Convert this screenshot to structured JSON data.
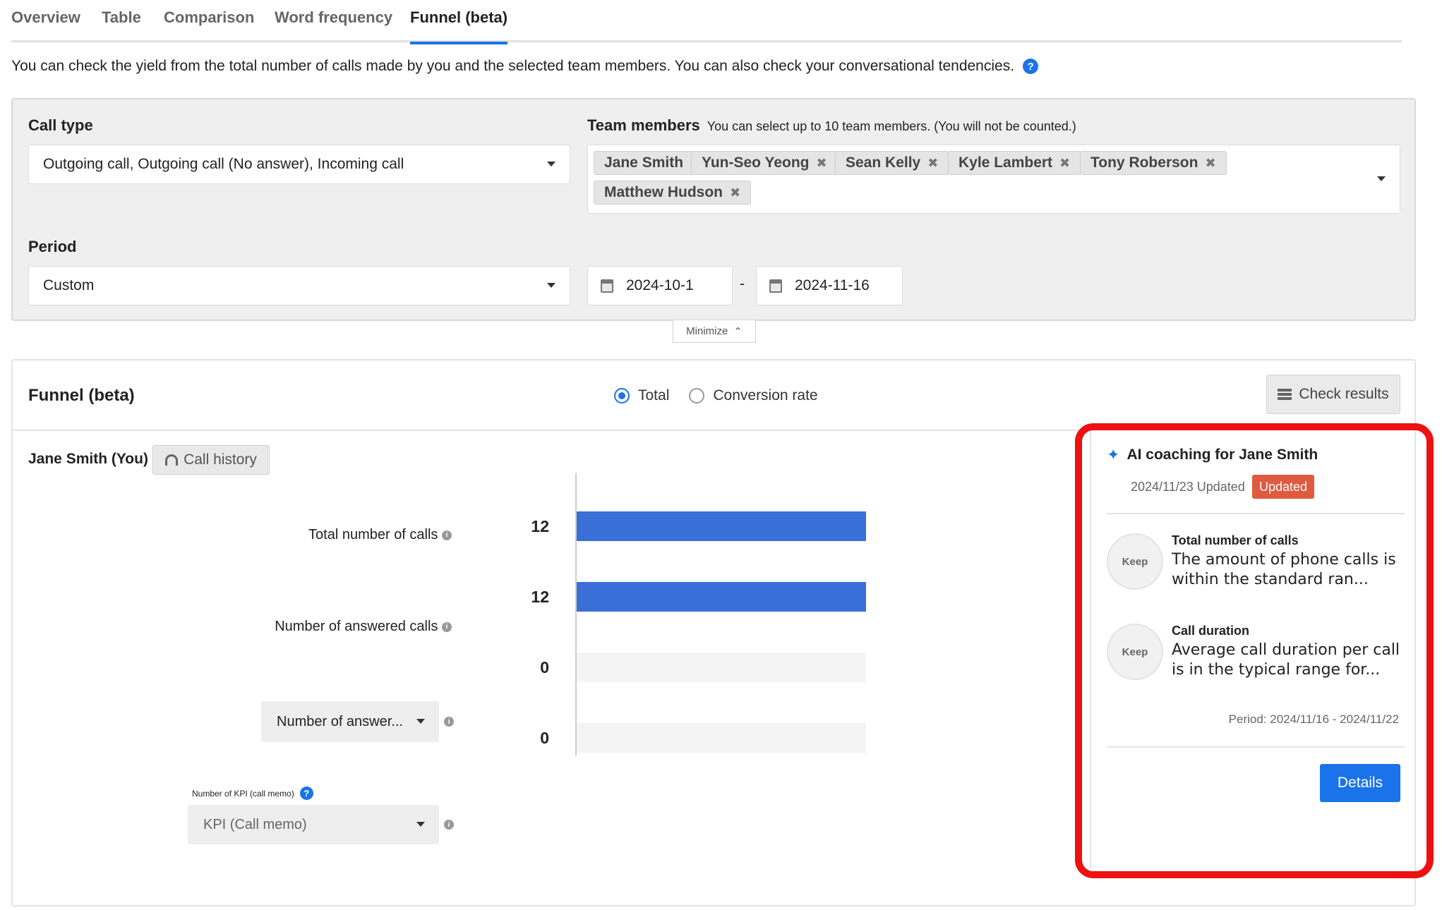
{
  "tabs": [
    {
      "label": "Overview"
    },
    {
      "label": "Table"
    },
    {
      "label": "Comparison"
    },
    {
      "label": "Word frequency"
    },
    {
      "label": "Funnel (beta)",
      "active": true
    }
  ],
  "description": "You can check the yield from the total number of calls made by you and the selected team members. You can also check your conversational tendencies.",
  "filters": {
    "call_type_label": "Call type",
    "call_type_value": "Outgoing call, Outgoing call (No answer), Incoming call",
    "team_members_label": "Team members",
    "team_members_note": "You can select up to 10 team members. (You will not be counted.)",
    "team_members": [
      {
        "name": "Jane Smith",
        "removable": false
      },
      {
        "name": "Yun-Seo Yeong",
        "removable": true
      },
      {
        "name": "Sean Kelly",
        "removable": true
      },
      {
        "name": "Kyle Lambert",
        "removable": true
      },
      {
        "name": "Tony Roberson",
        "removable": true
      },
      {
        "name": "Matthew Hudson",
        "removable": true
      }
    ],
    "period_label": "Period",
    "period_value": "Custom",
    "date_from": "2024-10-1",
    "date_separator": "-",
    "date_to": "2024-11-16",
    "minimize_label": "Minimize"
  },
  "funnel": {
    "title": "Funnel (beta)",
    "view_options": [
      {
        "label": "Total",
        "selected": true
      },
      {
        "label": "Conversion rate",
        "selected": false
      }
    ],
    "check_results_label": "Check results",
    "user_name": "Jane Smith (You)",
    "call_history_label": "Call history",
    "kpi_label": "Number of KPI (call memo)",
    "kpi_select_value": "KPI (Call memo)",
    "answer_select_value": "Number of answer..."
  },
  "chart_data": {
    "type": "bar",
    "orientation": "horizontal",
    "categories": [
      "Total number of calls",
      "Number of answered calls",
      "Number of answer...",
      "KPI (Call memo)"
    ],
    "values": [
      12,
      12,
      0,
      0
    ],
    "xlim": [
      0,
      12
    ],
    "colors": {
      "bar": "#3b6fd8",
      "track": "#f4f4f4",
      "axis": "#cccccc"
    }
  },
  "coaching": {
    "title": "AI coaching for Jane Smith",
    "updated_text": "2024/11/23 Updated",
    "updated_badge": "Updated",
    "items": [
      {
        "status": "Keep",
        "title": "Total number of calls",
        "text": "The amount of phone calls is within the standard ran..."
      },
      {
        "status": "Keep",
        "title": "Call duration",
        "text": "Average call duration per call is in the typical range for..."
      }
    ],
    "period": "Period: 2024/11/16 - 2024/11/22",
    "details_label": "Details"
  },
  "icons": {
    "help": "question-circle-icon",
    "calendar": "calendar-icon",
    "sparkle": "sparkle-icon",
    "table": "table-icon",
    "headset": "headset-icon"
  }
}
